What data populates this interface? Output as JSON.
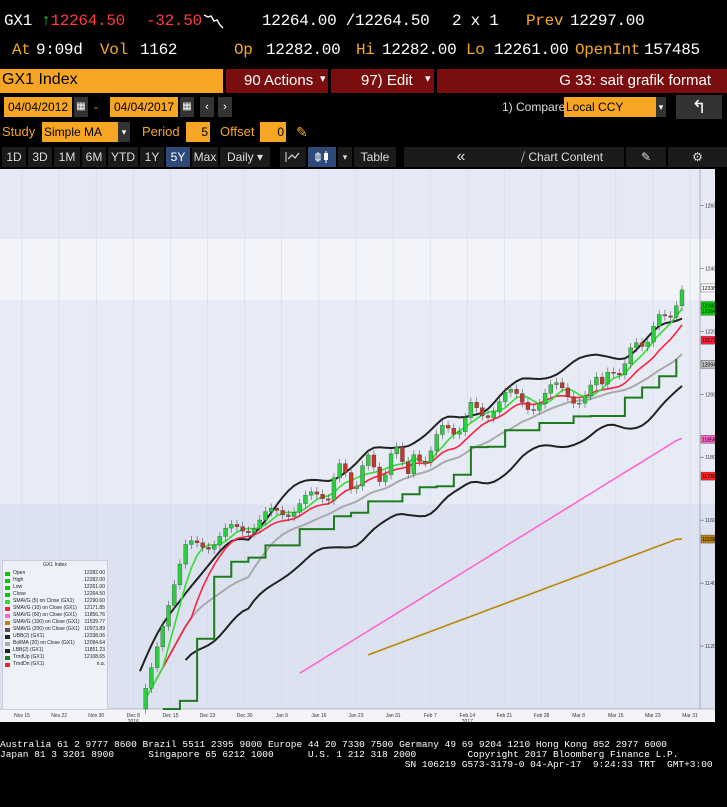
{
  "quote": {
    "ticker": "GX1",
    "arrow": "↑",
    "last": "12264.50",
    "change": "-32.50",
    "bid_ask": "12264.00 /12264.50",
    "size": "2 x 1",
    "prev_label": "Prev",
    "prev_value": "12297.00",
    "at_label": "At",
    "at_value": "9:09d",
    "vol_label": "Vol",
    "vol_value": "1162",
    "op_label": "Op",
    "op_value": "12282.00",
    "hi_label": "Hi",
    "hi_value": "12282.00",
    "lo_label": "Lo",
    "lo_value": "12261.00",
    "oi_label": "OpenInt",
    "oi_value": "157485"
  },
  "menubar": {
    "security": "GX1 Index",
    "actions": "90 Actions",
    "edit": "97) Edit",
    "title": "G 33: sait grafik format"
  },
  "datebar": {
    "start": "04/04/2012",
    "end": "04/04/2017",
    "compare_label": "1) Compare",
    "currency": "Local CCY"
  },
  "studybar": {
    "study_label": "Study",
    "study_value": "Simple MA",
    "period_label": "Period",
    "period_value": "5",
    "offset_label": "Offset",
    "offset_value": "0"
  },
  "toolbar": {
    "ranges": [
      "1D",
      "3D",
      "1M",
      "6M",
      "YTD",
      "1Y",
      "5Y",
      "Max"
    ],
    "frequency": "Daily",
    "table": "Table",
    "chart_content": "Chart Content"
  },
  "chart_data": {
    "type": "line",
    "y_ticks": [
      "12600",
      "12400",
      "12200",
      "12000",
      "11800",
      "11600",
      "11400",
      "11200"
    ],
    "y_range": [
      11000,
      12700
    ],
    "x_ticks": [
      "Nov 15",
      "Nov 22",
      "Nov 30",
      "Dec 8",
      "Dec 15",
      "Dec 23",
      "Dec 30",
      "Jan 9",
      "Jan 16",
      "Jan 23",
      "Jan 31",
      "Feb 7",
      "Feb 14",
      "Feb 21",
      "Feb 28",
      "Mar 8",
      "Mar 15",
      "Mar 23",
      "Mar 31"
    ],
    "year_labels": [
      {
        "label": "2016",
        "at": "Dec 8"
      },
      {
        "label": "2017",
        "at": "Feb 14"
      }
    ],
    "price_labels": [
      {
        "text": "12338.06",
        "color": "#ffffff",
        "value": 12338
      },
      {
        "text": "12282.00",
        "color": "#00d000",
        "value": 12282
      },
      {
        "text": "12264.50",
        "color": "#00d000",
        "value": 12264
      },
      {
        "text": "12171.85",
        "color": "#ff2040",
        "value": 12172
      },
      {
        "text": "12094.64",
        "color": "#c0c0c0",
        "value": 12095
      },
      {
        "text": "11856.76",
        "color": "#ff66cc",
        "value": 11857
      },
      {
        "text": "11739.77",
        "color": "#ff2020",
        "value": 11740
      },
      {
        "text": "11539.77",
        "color": "#b8860b",
        "value": 11540
      }
    ],
    "legend_title": "GX1 Index",
    "legend": [
      {
        "name": "Open",
        "value": "12282.00",
        "color": "#00cc00"
      },
      {
        "name": "High",
        "value": "12282.00",
        "color": "#00cc00"
      },
      {
        "name": "Low",
        "value": "12261.00",
        "color": "#00cc00"
      },
      {
        "name": "Close",
        "value": "12264.50",
        "color": "#00cc00"
      },
      {
        "name": "SMAVG (5) on Close (GX1)",
        "value": "12290.60",
        "color": "#33dd33"
      },
      {
        "name": "SMAVG (10) on Close (GX1)",
        "value": "12171.85",
        "color": "#ff2040"
      },
      {
        "name": "SMAVG (60) on Close (GX1)",
        "value": "11856.76",
        "color": "#ff66cc"
      },
      {
        "name": "SMAVG (100) on Close (GX1)",
        "value": "11539.77",
        "color": "#b8860b"
      },
      {
        "name": "SMAVG (200) on Close (GX1)",
        "value": "10973.89",
        "color": "#555555"
      },
      {
        "name": "UBB(2) (GX1)",
        "value": "12338.06",
        "color": "#222222"
      },
      {
        "name": "BollMA (20) on Close (GX1)",
        "value": "12094.64",
        "color": "#aaaaaa"
      },
      {
        "name": "LBB(2) (GX1)",
        "value": "11851.23",
        "color": "#222222"
      },
      {
        "name": "TrndUp (GX1)",
        "value": "12108.65",
        "color": "#1f7a1f"
      },
      {
        "name": "TrndDn (GX1)",
        "value": "n.a.",
        "color": "#ff2020"
      }
    ]
  },
  "footer": {
    "line1": "Australia 61 2 9777 8600 Brazil 5511 2395 9000 Europe 44 20 7330 7500 Germany 49 69 9204 1210 Hong Kong 852 2977 6000",
    "line2": "Japan 81 3 3201 8900      Singapore 65 6212 1000      U.S. 1 212 318 2000         Copyright 2017 Bloomberg Finance L.P.",
    "line3": "                                                                       SN 106219 G573-3179-0 04-Apr-17  9:24:33 TRT  GMT+3:00"
  },
  "colors": {
    "orange": "#f7a623",
    "bb_red": "#8b0e0e",
    "bb_darkred": "#6a1010"
  }
}
